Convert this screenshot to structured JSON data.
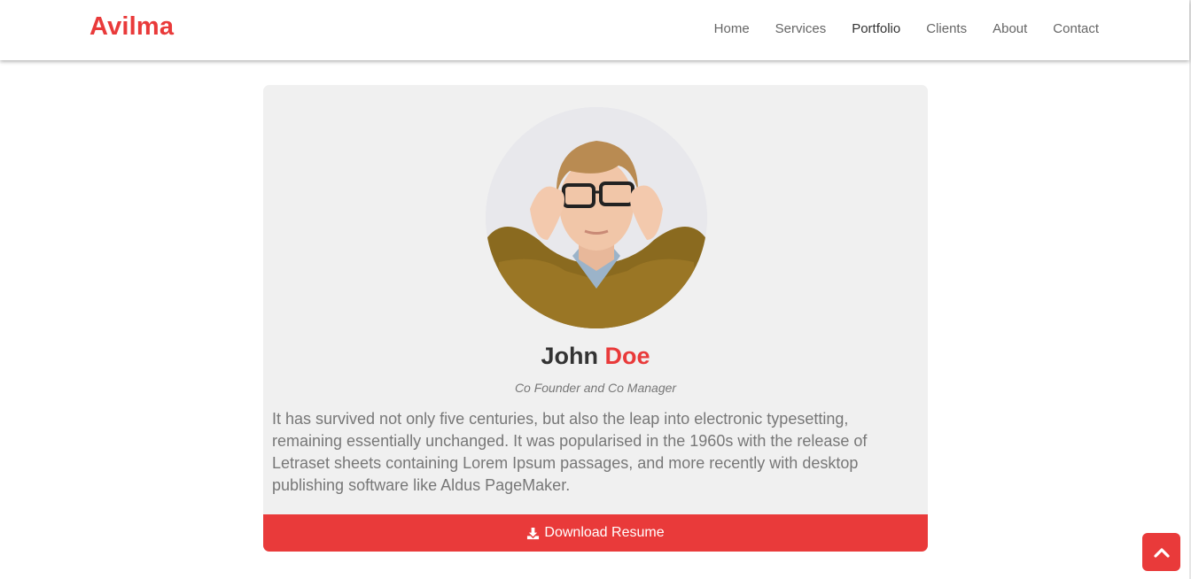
{
  "brand": "Avilma",
  "nav": {
    "items": [
      "Home",
      "Services",
      "Portfolio",
      "Clients",
      "About",
      "Contact"
    ],
    "active": "Portfolio"
  },
  "profile": {
    "first_name": "John",
    "last_name": "Doe",
    "role": "Co Founder and Co Manager",
    "bio": "It has survived not only five centuries, but also the leap into electronic typesetting, remaining essentially unchanged. It was popularised in the 1960s with the release of Letraset sheets containing Lorem Ipsum passages, and more recently with desktop publishing software like Aldus PageMaker.",
    "download_label": "Download Resume",
    "download_icon": "download-icon",
    "avatar_icon": "person-photo"
  },
  "scroll_top_icon": "chevron-up-icon",
  "colors": {
    "accent": "#e93a3a",
    "card_bg": "#f0f0f0",
    "text_muted": "#777777"
  }
}
